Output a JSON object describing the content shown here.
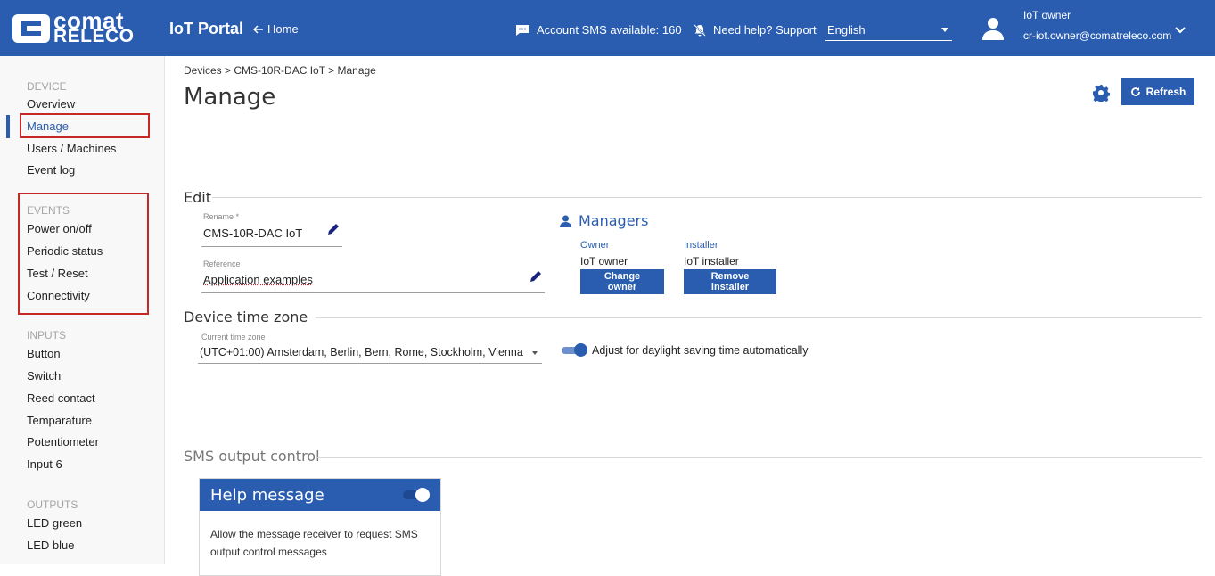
{
  "header": {
    "logo_line1": "comat",
    "logo_line2": "RELECO",
    "app_title": "IoT Portal",
    "home_label": "Home",
    "sms_available": "Account SMS available: 160",
    "support": "Need help? Support",
    "language": "English",
    "user_name": "IoT owner",
    "user_email": "cr-iot.owner@comatreleco.com"
  },
  "sidebar": {
    "device_section": "DEVICE",
    "device_items": [
      "Overview",
      "Manage",
      "Users / Machines",
      "Event log"
    ],
    "events_section": "EVENTS",
    "events_items": [
      "Power on/off",
      "Periodic status",
      "Test / Reset",
      "Connectivity"
    ],
    "inputs_section": "INPUTS",
    "inputs_items": [
      "Button",
      "Switch",
      "Reed contact",
      "Temparature",
      "Potentiometer",
      "Input 6"
    ],
    "outputs_section": "OUTPUTS",
    "outputs_items": [
      "LED green",
      "LED blue"
    ]
  },
  "main": {
    "breadcrumb": "Devices > CMS-10R-DAC IoT > Manage",
    "title": "Manage",
    "refresh_label": "Refresh",
    "edit": {
      "section_title": "Edit",
      "rename_label": "Rename *",
      "rename_value": "CMS-10R-DAC IoT",
      "reference_label": "Reference",
      "reference_value": "Application examples"
    },
    "managers": {
      "title": "Managers",
      "owner_label": "Owner",
      "owner_value": "IoT owner",
      "installer_label": "Installer",
      "installer_value": "IoT installer",
      "change_owner": "Change owner",
      "remove_installer": "Remove installer"
    },
    "timezone": {
      "section_title": "Device time zone",
      "current_label": "Current time zone",
      "current_value": "(UTC+01:00) Amsterdam, Berlin, Bern, Rome, Stockholm, Vienna",
      "dst_label": "Adjust for daylight saving time automatically"
    },
    "sms": {
      "section_title": "SMS output control",
      "card_title": "Help message",
      "card_body": "Allow the message receiver to request SMS output control messages"
    }
  },
  "colors": {
    "primary": "#2a5db0",
    "highlight_box": "#c62828"
  }
}
